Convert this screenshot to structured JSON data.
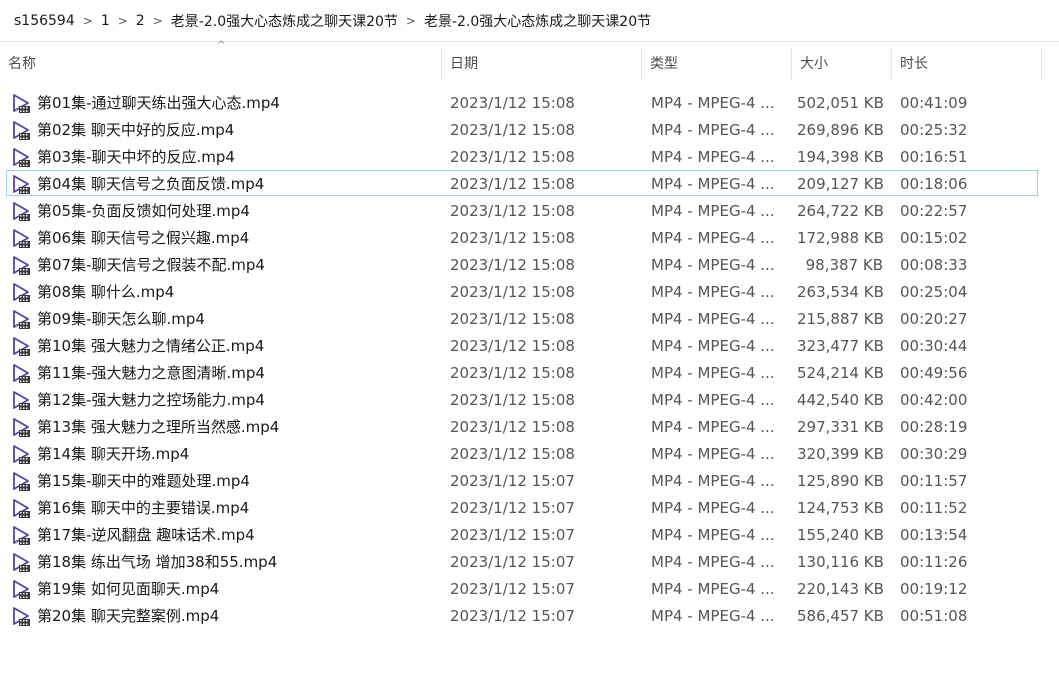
{
  "breadcrumb": {
    "items": [
      "s156594",
      "1",
      "2",
      "老景-2.0强大心态炼成之聊天课20节",
      "老景-2.0强大心态炼成之聊天课20节"
    ],
    "separator": ">"
  },
  "columns": {
    "name": "名称",
    "date": "日期",
    "type": "类型",
    "size": "大小",
    "duration": "时长",
    "sort_indicator": "^"
  },
  "file_icon": "video-file-icon",
  "files": [
    {
      "name": "第01集-通过聊天练出强大心态.mp4",
      "date": "2023/1/12 15:08",
      "type": "MP4 - MPEG-4 ...",
      "size": "502,051 KB",
      "duration": "00:41:09"
    },
    {
      "name": "第02集 聊天中好的反应.mp4",
      "date": "2023/1/12 15:08",
      "type": "MP4 - MPEG-4 ...",
      "size": "269,896 KB",
      "duration": "00:25:32"
    },
    {
      "name": "第03集-聊天中坏的反应.mp4",
      "date": "2023/1/12 15:08",
      "type": "MP4 - MPEG-4 ...",
      "size": "194,398 KB",
      "duration": "00:16:51"
    },
    {
      "name": "第04集 聊天信号之负面反馈.mp4",
      "date": "2023/1/12 15:08",
      "type": "MP4 - MPEG-4 ...",
      "size": "209,127 KB",
      "duration": "00:18:06"
    },
    {
      "name": "第05集-负面反馈如何处理.mp4",
      "date": "2023/1/12 15:08",
      "type": "MP4 - MPEG-4 ...",
      "size": "264,722 KB",
      "duration": "00:22:57"
    },
    {
      "name": "第06集 聊天信号之假兴趣.mp4",
      "date": "2023/1/12 15:08",
      "type": "MP4 - MPEG-4 ...",
      "size": "172,988 KB",
      "duration": "00:15:02"
    },
    {
      "name": "第07集-聊天信号之假装不配.mp4",
      "date": "2023/1/12 15:08",
      "type": "MP4 - MPEG-4 ...",
      "size": "98,387 KB",
      "duration": "00:08:33"
    },
    {
      "name": "第08集 聊什么.mp4",
      "date": "2023/1/12 15:08",
      "type": "MP4 - MPEG-4 ...",
      "size": "263,534 KB",
      "duration": "00:25:04"
    },
    {
      "name": "第09集-聊天怎么聊.mp4",
      "date": "2023/1/12 15:08",
      "type": "MP4 - MPEG-4 ...",
      "size": "215,887 KB",
      "duration": "00:20:27"
    },
    {
      "name": "第10集 强大魅力之情绪公正.mp4",
      "date": "2023/1/12 15:08",
      "type": "MP4 - MPEG-4 ...",
      "size": "323,477 KB",
      "duration": "00:30:44"
    },
    {
      "name": "第11集-强大魅力之意图清晰.mp4",
      "date": "2023/1/12 15:08",
      "type": "MP4 - MPEG-4 ...",
      "size": "524,214 KB",
      "duration": "00:49:56"
    },
    {
      "name": "第12集-强大魅力之控场能力.mp4",
      "date": "2023/1/12 15:08",
      "type": "MP4 - MPEG-4 ...",
      "size": "442,540 KB",
      "duration": "00:42:00"
    },
    {
      "name": "第13集 强大魅力之理所当然感.mp4",
      "date": "2023/1/12 15:08",
      "type": "MP4 - MPEG-4 ...",
      "size": "297,331 KB",
      "duration": "00:28:19"
    },
    {
      "name": "第14集 聊天开场.mp4",
      "date": "2023/1/12 15:08",
      "type": "MP4 - MPEG-4 ...",
      "size": "320,399 KB",
      "duration": "00:30:29"
    },
    {
      "name": "第15集-聊天中的难题处理.mp4",
      "date": "2023/1/12 15:07",
      "type": "MP4 - MPEG-4 ...",
      "size": "125,890 KB",
      "duration": "00:11:57"
    },
    {
      "name": "第16集 聊天中的主要错误.mp4",
      "date": "2023/1/12 15:07",
      "type": "MP4 - MPEG-4 ...",
      "size": "124,753 KB",
      "duration": "00:11:52"
    },
    {
      "name": "第17集-逆风翻盘 趣味话术.mp4",
      "date": "2023/1/12 15:07",
      "type": "MP4 - MPEG-4 ...",
      "size": "155,240 KB",
      "duration": "00:13:54"
    },
    {
      "name": "第18集 练出气场 增加38和55.mp4",
      "date": "2023/1/12 15:07",
      "type": "MP4 - MPEG-4 ...",
      "size": "130,116 KB",
      "duration": "00:11:26"
    },
    {
      "name": "第19集 如何见面聊天.mp4",
      "date": "2023/1/12 15:07",
      "type": "MP4 - MPEG-4 ...",
      "size": "220,143 KB",
      "duration": "00:19:12"
    },
    {
      "name": "第20集 聊天完整案例.mp4",
      "date": "2023/1/12 15:07",
      "type": "MP4 - MPEG-4 ...",
      "size": "586,457 KB",
      "duration": "00:51:08"
    }
  ]
}
